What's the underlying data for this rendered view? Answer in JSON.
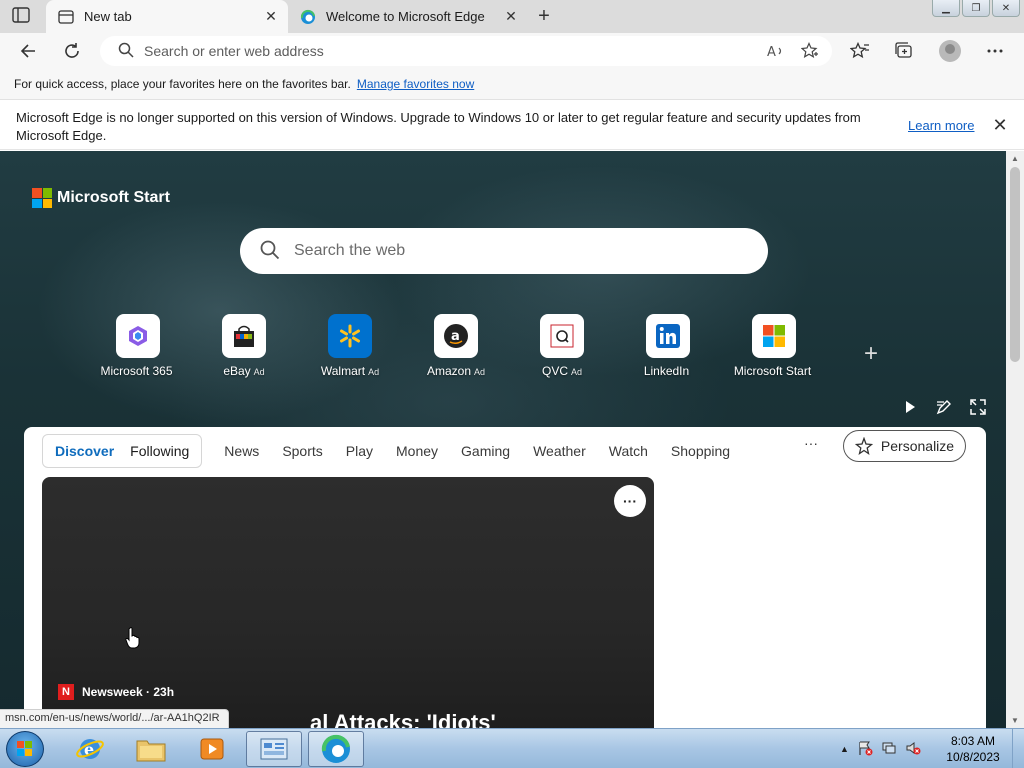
{
  "tabs": [
    {
      "title": "New tab",
      "active": true
    },
    {
      "title": "Welcome to Microsoft Edge",
      "active": false
    }
  ],
  "address_bar": {
    "placeholder": "Search or enter web address"
  },
  "favorites_bar": {
    "message": "For quick access, place your favorites here on the favorites bar.",
    "link": "Manage favorites now"
  },
  "notice": {
    "message": "Microsoft Edge is no longer supported on this version of Windows. Upgrade to Windows 10 or later to get regular feature and security updates from Microsoft Edge.",
    "learn_more": "Learn more"
  },
  "start_page": {
    "brand": "Microsoft Start",
    "search_placeholder": "Search the web",
    "quick_links": [
      {
        "label": "Microsoft 365",
        "ad": ""
      },
      {
        "label": "eBay",
        "ad": "Ad"
      },
      {
        "label": "Walmart",
        "ad": "Ad"
      },
      {
        "label": "Amazon",
        "ad": "Ad"
      },
      {
        "label": "QVC",
        "ad": "Ad"
      },
      {
        "label": "LinkedIn",
        "ad": ""
      },
      {
        "label": "Microsoft Start",
        "ad": ""
      }
    ],
    "add_link": "+"
  },
  "feed": {
    "pill_tabs": [
      "Discover",
      "Following"
    ],
    "categories": [
      "News",
      "Sports",
      "Play",
      "Money",
      "Gaming",
      "Weather",
      "Watch",
      "Shopping"
    ],
    "more": "···",
    "personalize": "Personalize",
    "hero": {
      "source": "Newsweek · 23h",
      "source_logo_letter": "N",
      "headline": "al Attacks: 'Idiots'"
    }
  },
  "status_url": "msn.com/en-us/news/world/.../ar-AA1hQ2IR",
  "taskbar": {
    "time": "8:03 AM",
    "date": "10/8/2023"
  },
  "colors": {
    "accent": "#0f6cbd",
    "link": "#0f5ec4",
    "tab_strip": "#dcdcdc",
    "toolbar": "#f7f7f7"
  }
}
